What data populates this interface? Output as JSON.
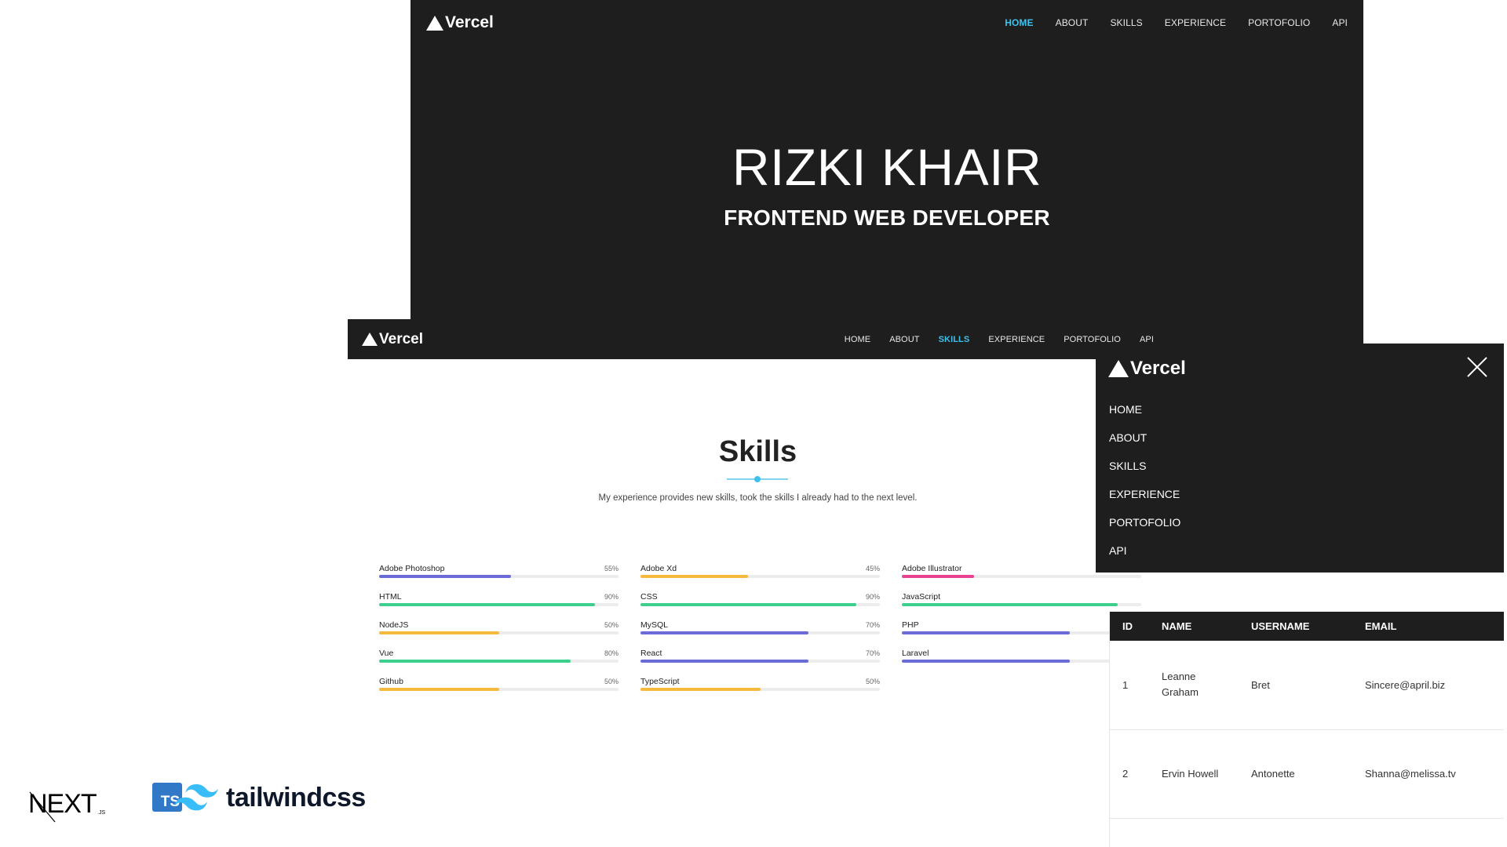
{
  "hero": {
    "logo": "Vercel",
    "nav": [
      "HOME",
      "ABOUT",
      "SKILLS",
      "EXPERIENCE",
      "PORTOFOLIO",
      "API"
    ],
    "active": "HOME",
    "name": "RIZKI KHAIR",
    "role": "FRONTEND WEB DEVELOPER"
  },
  "skills": {
    "logo": "Vercel",
    "nav": [
      "HOME",
      "ABOUT",
      "SKILLS",
      "EXPERIENCE",
      "PORTOFOLIO",
      "API"
    ],
    "active": "SKILLS",
    "title": "Skills",
    "subtitle": "My experience provides new skills, took the skills I already had to the next level.",
    "items": [
      {
        "label": "Adobe Photoshop",
        "percent": 55,
        "pct_text": "55%",
        "color": "#6b6bd8"
      },
      {
        "label": "Adobe Xd",
        "percent": 45,
        "pct_text": "45%",
        "color": "#f6b93b"
      },
      {
        "label": "Adobe Illustrator",
        "percent": 30,
        "pct_text": "",
        "color": "#e84393"
      },
      {
        "label": "HTML",
        "percent": 90,
        "pct_text": "90%",
        "color": "#3ecf8e"
      },
      {
        "label": "CSS",
        "percent": 90,
        "pct_text": "90%",
        "color": "#3ecf8e"
      },
      {
        "label": "JavaScript",
        "percent": 90,
        "pct_text": "",
        "color": "#3ecf8e"
      },
      {
        "label": "NodeJS",
        "percent": 50,
        "pct_text": "50%",
        "color": "#f6b93b"
      },
      {
        "label": "MySQL",
        "percent": 70,
        "pct_text": "70%",
        "color": "#6b6bd8"
      },
      {
        "label": "PHP",
        "percent": 70,
        "pct_text": "",
        "color": "#6b6bd8"
      },
      {
        "label": "Vue",
        "percent": 80,
        "pct_text": "80%",
        "color": "#3ecf8e"
      },
      {
        "label": "React",
        "percent": 70,
        "pct_text": "70%",
        "color": "#6b6bd8"
      },
      {
        "label": "Laravel",
        "percent": 70,
        "pct_text": "",
        "color": "#6b6bd8"
      },
      {
        "label": "Github",
        "percent": 50,
        "pct_text": "50%",
        "color": "#f6b93b"
      },
      {
        "label": "TypeScript",
        "percent": 50,
        "pct_text": "50%",
        "color": "#f6b93b"
      }
    ]
  },
  "mobile_menu": {
    "logo": "Vercel",
    "items": [
      "HOME",
      "ABOUT",
      "SKILLS",
      "EXPERIENCE",
      "PORTOFOLIO",
      "API"
    ]
  },
  "users_table": {
    "headers": [
      "ID",
      "NAME",
      "USERNAME",
      "EMAIL"
    ],
    "rows": [
      {
        "id": "1",
        "name": "Leanne Graham",
        "username": "Bret",
        "email": "Sincere@april.biz"
      },
      {
        "id": "2",
        "name": "Ervin Howell",
        "username": "Antonette",
        "email": "Shanna@melissa.tv"
      }
    ]
  },
  "tech": {
    "next_label": "NEXT",
    "next_suffix": ".JS",
    "ts_label": "TS",
    "tailwind_label": "tailwindcss",
    "colors": {
      "ts": "#3178c6",
      "tailwind": "#38bdf8"
    }
  },
  "colors": {
    "accent": "#3bc2ee",
    "dark": "#1e1e1e"
  }
}
